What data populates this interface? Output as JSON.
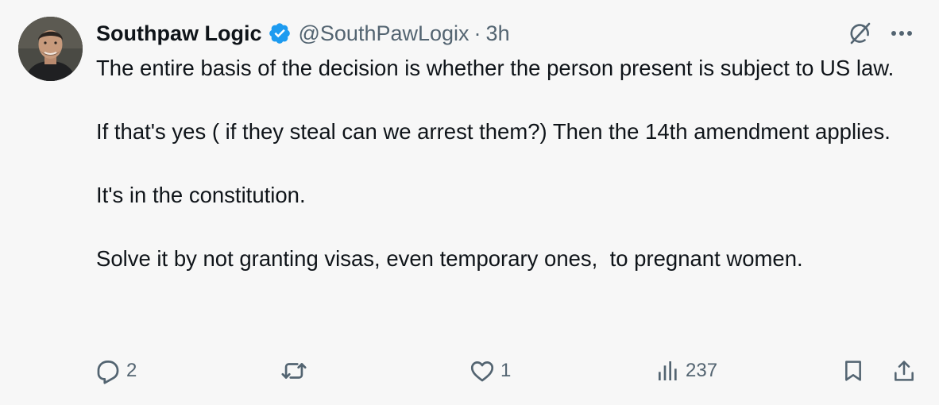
{
  "tweet": {
    "author": {
      "display_name": "Southpaw Logic",
      "handle": "@SouthPawLogix",
      "verified": true
    },
    "separator": "·",
    "timestamp": "3h",
    "paragraphs": [
      "The entire basis of the decision is whether the person present is subject to US law.",
      "If that's yes ( if they steal can we arrest them?) Then the 14th amendment applies.",
      "It's in the constitution.",
      "Solve it by not granting visas, even temporary ones,  to pregnant women."
    ],
    "actions": {
      "reply_count": "2",
      "repost_count": "",
      "like_count": "1",
      "views_count": "237"
    }
  },
  "icons": {
    "verified": "verified-badge-icon",
    "grok": "grok-icon",
    "more": "more-icon",
    "reply": "reply-icon",
    "repost": "repost-icon",
    "like": "heart-icon",
    "views": "views-icon",
    "bookmark": "bookmark-icon",
    "share": "share-icon"
  },
  "colors": {
    "background": "#f7f7f7",
    "text": "#0f1419",
    "secondary": "#536471",
    "verified": "#1d9bf0"
  }
}
